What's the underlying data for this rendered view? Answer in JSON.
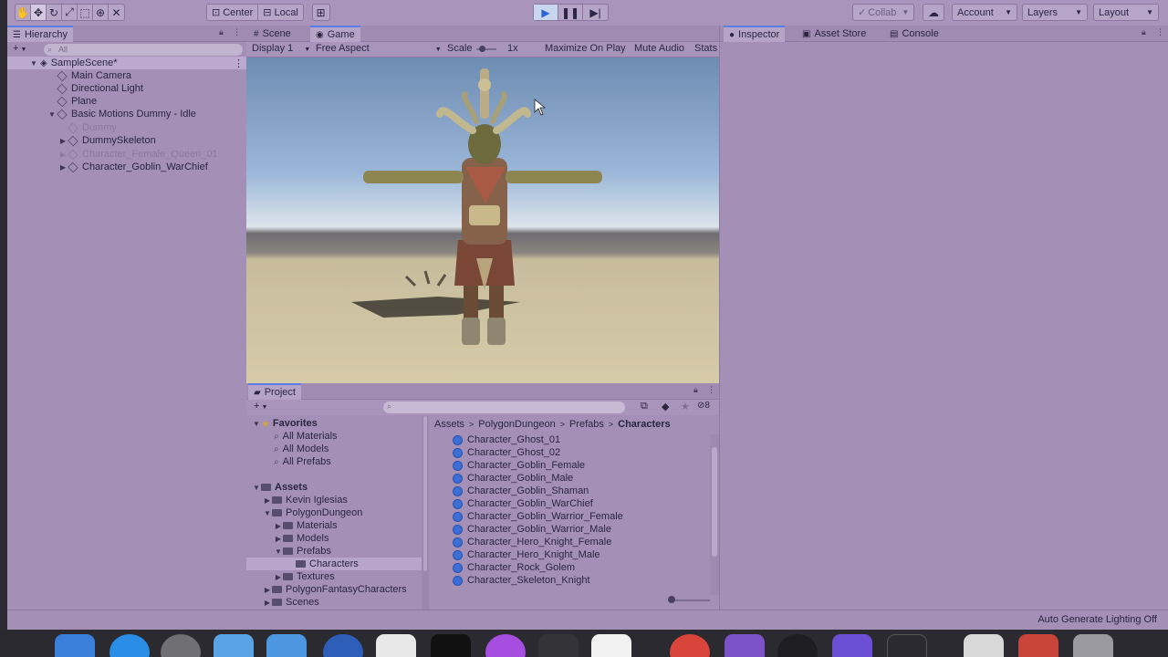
{
  "toolbar": {
    "center_label": "Center",
    "local_label": "Local",
    "collab_label": "Collab",
    "account_label": "Account",
    "layers_label": "Layers",
    "layout_label": "Layout",
    "tools": [
      "hand-tool-icon",
      "move-tool-icon",
      "rotate-tool-icon",
      "scale-tool-icon",
      "rect-tool-icon",
      "transform-tool-icon",
      "custom-tool-icon"
    ]
  },
  "hierarchy": {
    "tab_label": "Hierarchy",
    "search_placeholder": "All",
    "scene_name": "SampleScene*",
    "items": [
      {
        "label": "Main Camera"
      },
      {
        "label": "Directional Light"
      },
      {
        "label": "Plane"
      },
      {
        "label": "Basic Motions Dummy - Idle"
      },
      {
        "label": "Dummy"
      },
      {
        "label": "DummySkeleton"
      },
      {
        "label": "Character_Female_Queen_01"
      },
      {
        "label": "Character_Goblin_WarChief"
      }
    ]
  },
  "game": {
    "tabs": {
      "scene": "Scene",
      "game": "Game"
    },
    "display": "Display 1",
    "aspect": "Free Aspect",
    "scale_label": "Scale",
    "scale_value": "1x",
    "maximize_on_play": "Maximize On Play",
    "mute_audio": "Mute Audio",
    "stats": "Stats"
  },
  "project": {
    "tab_label": "Project",
    "hidden_count": "8",
    "favorites_label": "Favorites",
    "favorites": [
      "All Materials",
      "All Models",
      "All Prefabs"
    ],
    "assets_label": "Assets",
    "tree": [
      {
        "label": "Kevin Iglesias"
      },
      {
        "label": "PolygonDungeon"
      },
      {
        "label": "Materials"
      },
      {
        "label": "Models"
      },
      {
        "label": "Prefabs"
      },
      {
        "label": "Characters"
      },
      {
        "label": "Textures"
      },
      {
        "label": "PolygonFantasyCharacters"
      },
      {
        "label": "Scenes"
      }
    ],
    "breadcrumb": [
      "Assets",
      "PolygonDungeon",
      "Prefabs",
      "Characters"
    ],
    "files": [
      "Character_Ghost_01",
      "Character_Ghost_02",
      "Character_Goblin_Female",
      "Character_Goblin_Male",
      "Character_Goblin_Shaman",
      "Character_Goblin_WarChief",
      "Character_Goblin_Warrior_Female",
      "Character_Goblin_Warrior_Male",
      "Character_Hero_Knight_Female",
      "Character_Hero_Knight_Male",
      "Character_Rock_Golem",
      "Character_Skeleton_Knight"
    ]
  },
  "inspector": {
    "tabs": {
      "inspector": "Inspector",
      "asset_store": "Asset Store",
      "console": "Console"
    }
  },
  "status": {
    "text": "Auto Generate Lighting Off"
  }
}
